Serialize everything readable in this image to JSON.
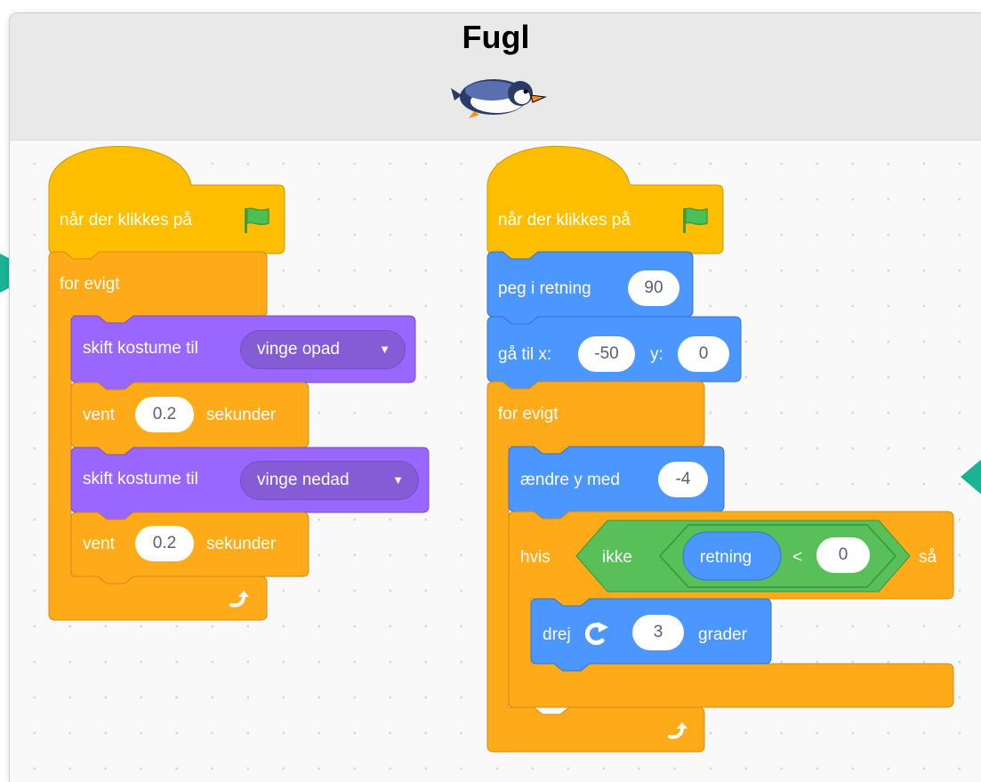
{
  "sprite": {
    "name": "Fugl",
    "icon": "penguin-bird-icon"
  },
  "colors": {
    "events": "#ffbf00",
    "control": "#ffab19",
    "looks": "#9966ff",
    "motion": "#4c97ff",
    "operators": "#59c059",
    "arrow": "#1ab394"
  },
  "script1": {
    "hat": {
      "label": "når der klikkes på",
      "icon": "green-flag-icon"
    },
    "forever_label": "for evigt",
    "switch1": {
      "label": "skift kostume til",
      "value": "vinge opad"
    },
    "wait1": {
      "label": "vent",
      "value": "0.2",
      "unit": "sekunder"
    },
    "switch2": {
      "label": "skift kostume til",
      "value": "vinge nedad"
    },
    "wait2": {
      "label": "vent",
      "value": "0.2",
      "unit": "sekunder"
    },
    "loop_icon": "loop-arrow-icon"
  },
  "script2": {
    "hat": {
      "label": "når der klikkes på",
      "icon": "green-flag-icon"
    },
    "point": {
      "label": "peg i retning",
      "value": "90"
    },
    "goto": {
      "label_x": "gå til x:",
      "x": "-50",
      "label_y": "y:",
      "y": "0"
    },
    "forever_label": "for evigt",
    "change_y": {
      "label": "ændre y med",
      "value": "-4"
    },
    "if": {
      "label": "hvis",
      "not_label": "ikke",
      "reporter": "retning",
      "operator": "<",
      "compare_value": "0",
      "then_label": "så"
    },
    "turn": {
      "label": "drej",
      "icon": "rotate-right-icon",
      "value": "3",
      "unit": "grader"
    },
    "loop_icon": "loop-arrow-icon"
  }
}
